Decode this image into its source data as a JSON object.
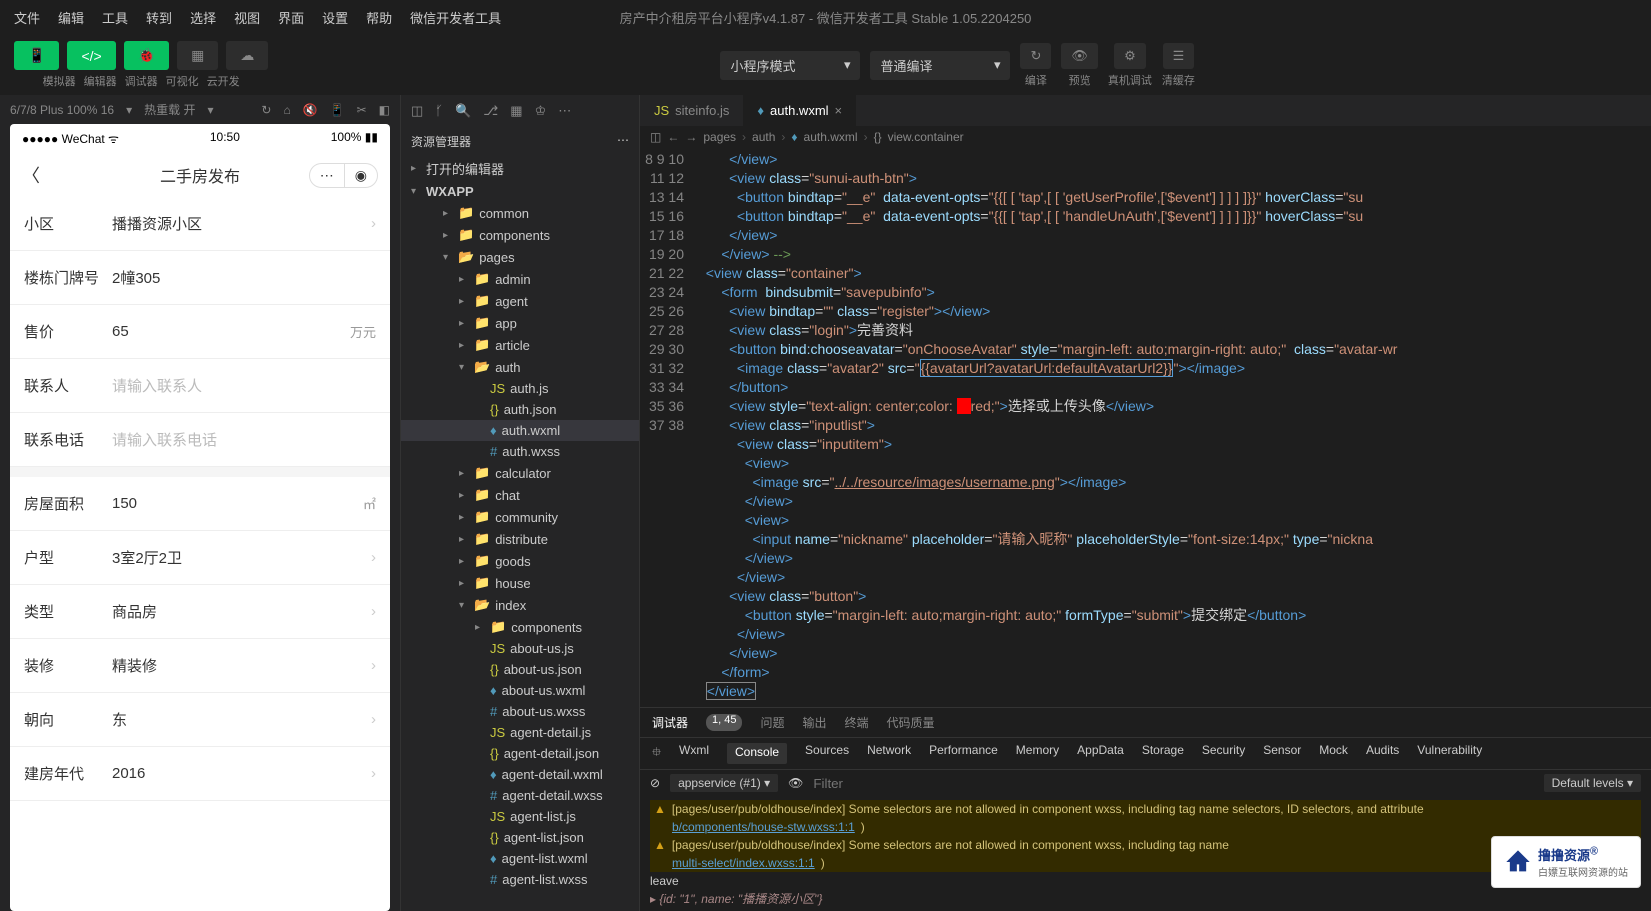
{
  "menubar": [
    "文件",
    "编辑",
    "工具",
    "转到",
    "选择",
    "视图",
    "界面",
    "设置",
    "帮助",
    "微信开发者工具"
  ],
  "window_title": "房产中介租房平台小程序v4.1.87 - 微信开发者工具 Stable 1.05.2204250",
  "toolbar": {
    "simulator": "模拟器",
    "editor": "编辑器",
    "debugger": "调试器",
    "visual": "可视化",
    "cloud": "云开发",
    "mode_select": "小程序模式",
    "compile_select": "普通编译",
    "compile": "编译",
    "preview": "预览",
    "remote": "真机调试",
    "cache": "清缓存"
  },
  "sim_bar": {
    "device": "6/7/8 Plus 100% 16",
    "reload": "热重载 开"
  },
  "phone": {
    "status": {
      "carrier": "WeChat",
      "time": "10:50",
      "battery": "100%"
    },
    "title": "二手房发布",
    "form": [
      {
        "label": "小区",
        "value": "播播资源小区",
        "chev": true
      },
      {
        "label": "楼栋门牌号",
        "value": "2幢305"
      },
      {
        "label": "售价",
        "value": "65",
        "unit": "万元"
      },
      {
        "label": "联系人",
        "placeholder": "请输入联系人"
      },
      {
        "label": "联系电话",
        "placeholder": "请输入联系电话"
      },
      {
        "gap": true
      },
      {
        "label": "房屋面积",
        "value": "150",
        "unit": "㎡"
      },
      {
        "label": "户型",
        "value": "3室2厅2卫",
        "chev": true
      },
      {
        "label": "类型",
        "value": "商品房",
        "chev": true
      },
      {
        "label": "装修",
        "value": "精装修",
        "chev": true
      },
      {
        "label": "朝向",
        "value": "东",
        "chev": true
      },
      {
        "label": "建房年代",
        "value": "2016",
        "chev": true
      }
    ]
  },
  "explorer": {
    "title": "资源管理器",
    "sections": {
      "open_editors": "打开的编辑器",
      "root": "WXAPP"
    },
    "tree": [
      {
        "d": 2,
        "t": "folder",
        "n": "common"
      },
      {
        "d": 2,
        "t": "folder",
        "n": "components"
      },
      {
        "d": 2,
        "t": "folder-open",
        "n": "pages",
        "open": true
      },
      {
        "d": 3,
        "t": "folder",
        "n": "admin"
      },
      {
        "d": 3,
        "t": "folder",
        "n": "agent"
      },
      {
        "d": 3,
        "t": "folder",
        "n": "app"
      },
      {
        "d": 3,
        "t": "folder",
        "n": "article"
      },
      {
        "d": 3,
        "t": "folder-open",
        "n": "auth",
        "open": true
      },
      {
        "d": 4,
        "t": "js",
        "n": "auth.js"
      },
      {
        "d": 4,
        "t": "json",
        "n": "auth.json"
      },
      {
        "d": 4,
        "t": "wxml",
        "n": "auth.wxml",
        "selected": true
      },
      {
        "d": 4,
        "t": "wxss",
        "n": "auth.wxss"
      },
      {
        "d": 3,
        "t": "folder",
        "n": "calculator"
      },
      {
        "d": 3,
        "t": "folder",
        "n": "chat"
      },
      {
        "d": 3,
        "t": "folder",
        "n": "community"
      },
      {
        "d": 3,
        "t": "folder",
        "n": "distribute"
      },
      {
        "d": 3,
        "t": "folder",
        "n": "goods"
      },
      {
        "d": 3,
        "t": "folder",
        "n": "house"
      },
      {
        "d": 3,
        "t": "folder-open",
        "n": "index",
        "open": true
      },
      {
        "d": 4,
        "t": "folder",
        "n": "components"
      },
      {
        "d": 4,
        "t": "js",
        "n": "about-us.js"
      },
      {
        "d": 4,
        "t": "json",
        "n": "about-us.json"
      },
      {
        "d": 4,
        "t": "wxml",
        "n": "about-us.wxml"
      },
      {
        "d": 4,
        "t": "wxss",
        "n": "about-us.wxss"
      },
      {
        "d": 4,
        "t": "js",
        "n": "agent-detail.js"
      },
      {
        "d": 4,
        "t": "json",
        "n": "agent-detail.json"
      },
      {
        "d": 4,
        "t": "wxml",
        "n": "agent-detail.wxml"
      },
      {
        "d": 4,
        "t": "wxss",
        "n": "agent-detail.wxss"
      },
      {
        "d": 4,
        "t": "js",
        "n": "agent-list.js"
      },
      {
        "d": 4,
        "t": "json",
        "n": "agent-list.json"
      },
      {
        "d": 4,
        "t": "wxml",
        "n": "agent-list.wxml"
      },
      {
        "d": 4,
        "t": "wxss",
        "n": "agent-list.wxss"
      }
    ]
  },
  "editor": {
    "tabs": [
      {
        "name": "siteinfo.js",
        "icon": "js"
      },
      {
        "name": "auth.wxml",
        "icon": "wxml",
        "active": true
      }
    ],
    "breadcrumb": [
      "pages",
      "auth",
      "auth.wxml",
      "view.container"
    ],
    "line_start": 8
  },
  "debug": {
    "tabs": {
      "debugger": "调试器",
      "count": "1, 45",
      "problems": "问题",
      "output": "输出",
      "terminal": "终端",
      "quality": "代码质量"
    },
    "devtools": [
      "Wxml",
      "Console",
      "Sources",
      "Network",
      "Performance",
      "Memory",
      "AppData",
      "Storage",
      "Security",
      "Sensor",
      "Mock",
      "Audits",
      "Vulnerability"
    ],
    "devtools_active": "Console",
    "context": "appservice (#1)",
    "filter_placeholder": "Filter",
    "levels": "Default levels",
    "warn1": "[pages/user/pub/oldhouse/index] Some selectors are not allowed in component wxss, including tag name selectors, ID selectors, and attribute",
    "warn1_link": "b/components/house-stw.wxss:1:1",
    "warn2": "[pages/user/pub/oldhouse/index] Some selectors are not allowed in component wxss, including tag name",
    "warn2_link": "multi-select/index.wxss:1:1",
    "leave": "leave",
    "obj": "{id: \"1\", name: \"播播资源小区\"}"
  },
  "watermark": {
    "title": "撸撸资源",
    "sub": "白嫖互联网资源的站",
    "reg": "®"
  }
}
